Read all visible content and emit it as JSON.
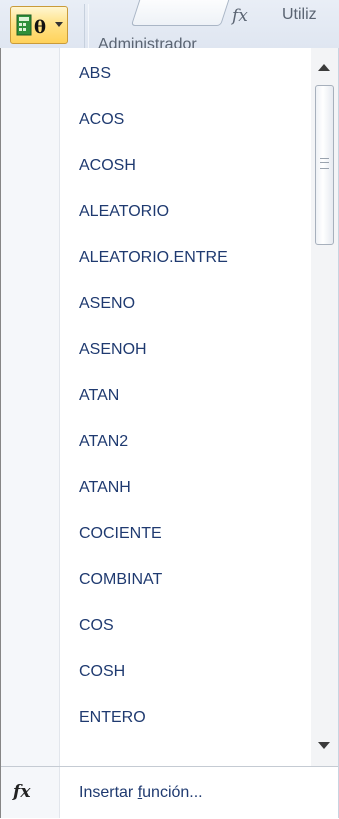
{
  "ribbon": {
    "partial_label": "Administrador",
    "utiliz_label": "Utiliz"
  },
  "menu": {
    "items": [
      "ABS",
      "ACOS",
      "ACOSH",
      "ALEATORIO",
      "ALEATORIO.ENTRE",
      "ASENO",
      "ASENOH",
      "ATAN",
      "ATAN2",
      "ATANH",
      "COCIENTE",
      "COMBINAT",
      "COS",
      "COSH",
      "ENTERO"
    ],
    "footer": {
      "label_pre": "Insertar ",
      "label_ul": "f",
      "label_post": "unción..."
    }
  },
  "colors": {
    "item_text": "#1f3a70",
    "accent_button": "#ffd25a"
  },
  "icons": {
    "math_trig": "math-trig-icon",
    "fx": "fx-icon"
  }
}
